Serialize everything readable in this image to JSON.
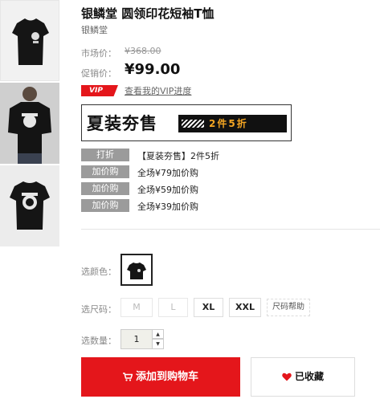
{
  "product": {
    "title": "银鳞堂 圆领印花短袖T恤",
    "brand": "银鳞堂"
  },
  "price": {
    "market_label": "市场价：",
    "market_value": "¥368.00",
    "sale_label": "促销价：",
    "sale_value": "¥99.00"
  },
  "vip": {
    "tag": "VIP",
    "link_text": "查看我的VIP进度"
  },
  "banner": {
    "text": "夏装夯售",
    "highlight": "2件5折"
  },
  "promotions": [
    {
      "tag": "打折",
      "text": "【夏装夯售】2件5折"
    },
    {
      "tag": "加价购",
      "text": "全场¥79加价购"
    },
    {
      "tag": "加价购",
      "text": "全场¥59加价购"
    },
    {
      "tag": "加价购",
      "text": "全场¥39加价购"
    }
  ],
  "options": {
    "color_label": "选颜色：",
    "size_label": "选尺码：",
    "sizes": [
      "M",
      "L",
      "XL",
      "XXL"
    ],
    "size_help": "尺码帮助",
    "qty_label": "选数量：",
    "qty_value": "1"
  },
  "actions": {
    "cart_label": "添加到购物车",
    "fav_label": "已收藏"
  },
  "colors": {
    "accent": "#e4161b",
    "promo_tag": "#9b9b9b"
  }
}
